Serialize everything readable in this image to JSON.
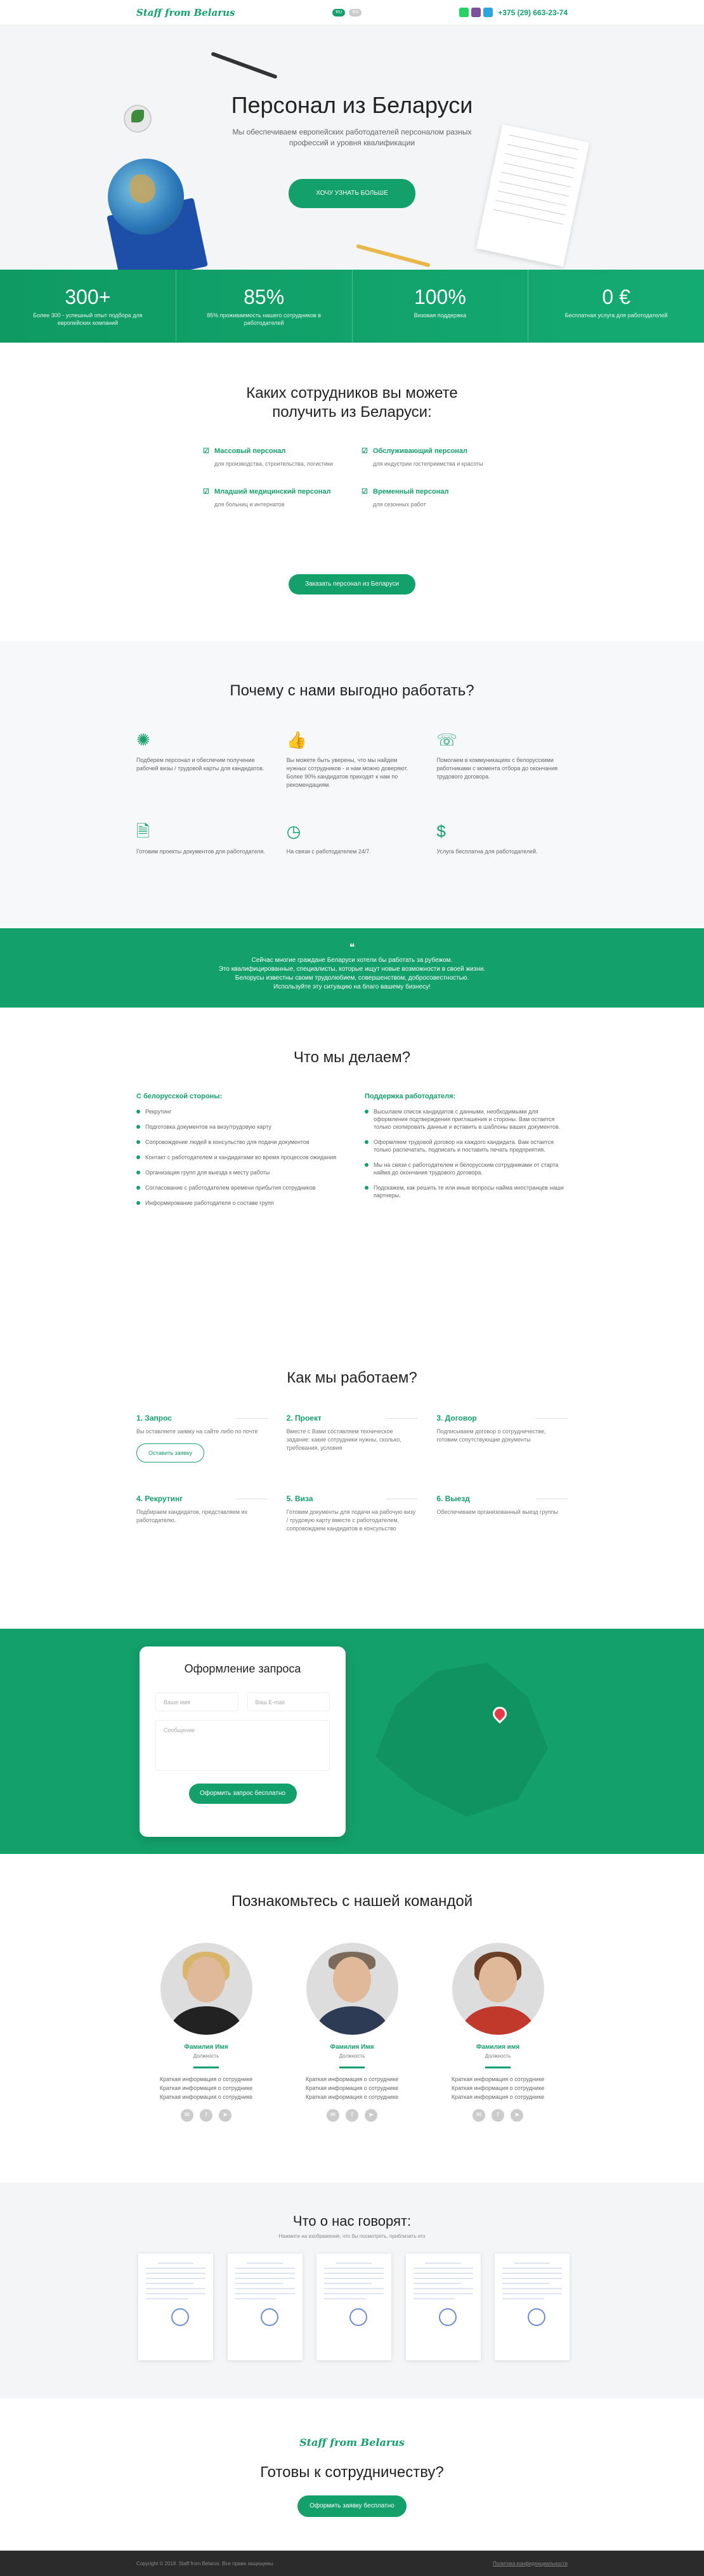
{
  "header": {
    "logo": "Staff from Belarus",
    "langs": [
      "RU",
      "EN"
    ],
    "phone": "+375 (29) 663-23-74"
  },
  "hero": {
    "title": "Персонал из Беларуси",
    "subtitle": "Мы обеспечиваем европейских работодателей персоналом разных профессий и уровня квалификации",
    "button": "ХОЧУ УЗНАТЬ БОЛЬШЕ"
  },
  "stats": [
    {
      "value": "300+",
      "text": "Более 300 - успешный опыт подбора для европейских компаний"
    },
    {
      "value": "85%",
      "text": "85% проживаемость нашего сотрудников в работодателей"
    },
    {
      "value": "100%",
      "text": "Визовая поддержка"
    },
    {
      "value": "0 €",
      "text": "Бесплатная услуга для работодателей"
    }
  ],
  "types": {
    "title": "Каких сотрудников вы можете получить из Беларуси:",
    "items": [
      {
        "name": "Массовый персонал",
        "desc": "для производства, строительства, логистики"
      },
      {
        "name": "Обслуживающий персонал",
        "desc": "для индустрии гостеприимства и красоты"
      },
      {
        "name": "Младший медицинский персонал",
        "desc": "для больниц и интернатов"
      },
      {
        "name": "Временный персонал",
        "desc": "для сезонных работ"
      }
    ],
    "button": "Заказать персонал из Беларуси"
  },
  "why": {
    "title": "Почему с нами выгодно работать?",
    "items": [
      {
        "icon": "network-icon",
        "text": "Подберем персонал и обеспечим получение рабочей визы / трудовой карты для кандидатов."
      },
      {
        "icon": "thumbs-up-icon",
        "text": "Вы можете быть уверены, что мы найдем нужных сотрудников - и нам можно доверяют. Более 90% кандидатов приходят к нам по рекомендациям."
      },
      {
        "icon": "support-agent-icon",
        "text": "Помогаем в коммуникациях с белорусскими работниками с момента отбора до окончания трудового договора."
      },
      {
        "icon": "document-icon",
        "text": "Готовим проекты документов для работодателя."
      },
      {
        "icon": "clock-icon",
        "text": "На связи с работодателем 24/7."
      },
      {
        "icon": "money-hand-icon",
        "text": "Услуга бесплатна для работодателей."
      }
    ]
  },
  "band": {
    "icon": "quote-icon",
    "lines": [
      "Сейчас многие граждане Беларуси хотели бы работать за рубежом.",
      "Это квалифицированные, специалисты, которые ищут новые возможности в своей жизни.",
      "Белорусы известны своим трудолюбием, совершенством, добросовестностью.",
      "Используйте эту ситуацию на благо вашему бизнесу!"
    ]
  },
  "whatwedo": {
    "title": "Что мы делаем?",
    "left_title": "С белорусской стороны:",
    "left": [
      "Рекрутинг",
      "Подготовка документов на визу/трудовую карту",
      "Сопровождение людей в консульство для подачи документов",
      "Контакт с работодателем и кандидатами во время процессов ожидания",
      "Организация групп для выезда к месту работы",
      "Согласование с работодателем времени прибытия сотрудников",
      "Информирование работодателя о составе групп"
    ],
    "right_title": "Поддержка работодателя:",
    "right": [
      "Высылаем список кандидатов с данными, необходимыми для оформления подтверждения приглашения и стороны. Вам остается только скопировать данные и вставить в шаблоны ваших документов.",
      "Оформляем трудовой договор на каждого кандидата. Вам остается только распечатать, подписать и поставить печать предприятия.",
      "Мы на связи с работодателем и белорусским сотрудниками от старта найма до окончания трудового договора.",
      "Подскажем, как решить те или иные вопросы найма иностранцев наши партнеры."
    ]
  },
  "how": {
    "title": "Как мы работаем?",
    "steps": [
      {
        "title": "1. Запрос",
        "text": "Вы оставляете заявку на сайте либо по почте"
      },
      {
        "title": "2. Проект",
        "text": "Вместе с Вами составляем техническое задание: какие сотрудники нужны, сколько, требования, условия"
      },
      {
        "title": "3. Договор",
        "text": "Подписываем договор о сотрудничестве, готовим сопутствующие документы"
      },
      {
        "title": "4. Рекрутинг",
        "text": "Подбираем кандидатов, представляем их работодателю."
      },
      {
        "title": "5. Виза",
        "text": "Готовим документы для подачи на рабочую визу / трудовую карту вместе с работодателем, сопровождаем кандидатов в консульство"
      },
      {
        "title": "6. Выезд",
        "text": "Обеспечиваем организованный выезд группы"
      }
    ],
    "button": "Оставить заявку"
  },
  "request": {
    "title": "Оформление запроса",
    "name_ph": "Ваше имя",
    "email_ph": "Ваш E-mail",
    "msg_ph": "Сообщение",
    "button": "Оформить запрос бесплатно"
  },
  "team": {
    "title": "Познакомьтесь с нашей командой",
    "members": [
      {
        "name": "Фамилия Имя",
        "position": "Должность",
        "info": [
          "Краткая информация о сотруднике",
          "Краткая информация о сотруднике",
          "Краткая информация о сотруднике"
        ]
      },
      {
        "name": "Фамилия Имя",
        "position": "Должность",
        "info": [
          "Краткая информация о сотруднике",
          "Краткая информация о сотруднике",
          "Краткая информация о сотруднике"
        ]
      },
      {
        "name": "Фамилия имя",
        "position": "Должность",
        "info": [
          "Краткая информация о сотруднике",
          "Краткая информация о сотруднике",
          "Краткая информация о сотруднике"
        ]
      }
    ],
    "social": [
      "mail-icon",
      "facebook-icon",
      "telegram-icon"
    ]
  },
  "reviews": {
    "title": "Что о нас говорят:",
    "subtitle": "Нажмите на изображение, что бы посмотреть, приблизить его"
  },
  "cta": {
    "logo": "Staff from Belarus",
    "title": "Готовы к сотрудничеству?",
    "button": "Оформить заявку бесплатно"
  },
  "footer": {
    "copyright": "Copyright © 2018. Staff from Belarus. Все права защищены.",
    "policy": "Политика конфиденциальности"
  },
  "colors": {
    "accent": "#13a06b"
  }
}
